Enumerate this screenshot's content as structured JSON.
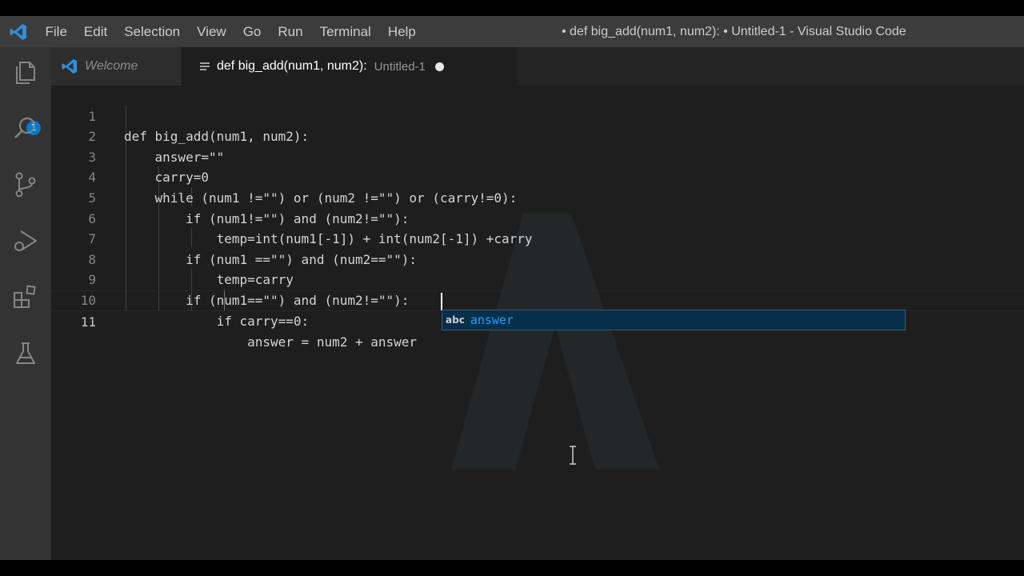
{
  "menu": {
    "items": [
      "File",
      "Edit",
      "Selection",
      "View",
      "Go",
      "Run",
      "Terminal",
      "Help"
    ]
  },
  "window": {
    "title": "• def big_add(num1, num2): • Untitled-1 - Visual Studio Code"
  },
  "activity_bar": {
    "explorer_badge": "1",
    "icons": [
      "files-icon",
      "search-icon",
      "source-control-icon",
      "run-debug-icon",
      "extensions-icon",
      "testing-icon"
    ]
  },
  "tabs": {
    "welcome": {
      "label": "Welcome"
    },
    "active": {
      "label": "def big_add(num1, num2):",
      "description": "Untitled-1",
      "dirty": true
    }
  },
  "editor": {
    "line_numbers": [
      "1",
      "2",
      "3",
      "4",
      "5",
      "6",
      "7",
      "8",
      "9",
      "10",
      "11"
    ],
    "lines": [
      "def big_add(num1, num2):",
      "    answer=\"\"",
      "    carry=0",
      "    while (num1 !=\"\") or (num2 !=\"\") or (carry!=0):",
      "        if (num1!=\"\") and (num2!=\"\"):",
      "            temp=int(num1[-1]) + int(num2[-1]) +carry",
      "        if (num1 ==\"\") and (num2==\"\"):",
      "            temp=carry",
      "        if (num1==\"\") and (num2!=\"\"):",
      "            if carry==0:",
      "                answer = num2 + answer"
    ],
    "current_line": 11
  },
  "suggest": {
    "kind": "abc",
    "label": "answer"
  },
  "colors": {
    "accent": "#007acc",
    "editor_bg": "#1e1e1e",
    "suggest_bg": "#062f4a",
    "suggest_text": "#18a3ff"
  }
}
